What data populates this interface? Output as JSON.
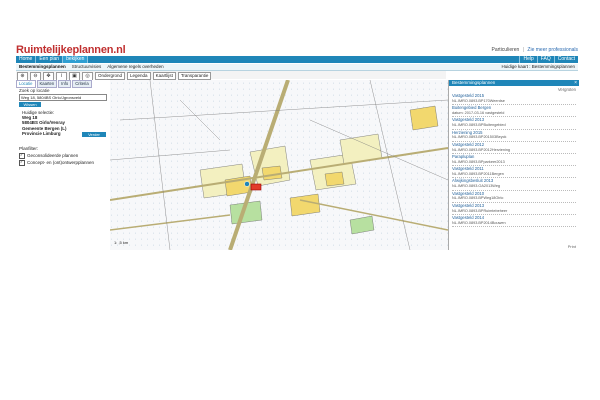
{
  "header": {
    "logo": "Ruimtelijkeplannen.nl",
    "top_links": [
      "Particulieren",
      "Zie meer professionals"
    ]
  },
  "nav": {
    "items": [
      "Home",
      "Een plan",
      "bekijken"
    ],
    "right_items": [
      "Help",
      "FAQ",
      "Contact"
    ]
  },
  "subnav": {
    "items": [
      "Bestemmingsplannen",
      "Structuurvisies",
      "Algemene regels overheden"
    ],
    "right": "Huidige kaart : Bestemmingsplannen"
  },
  "toolbar": {
    "labels": [
      "Ondergrond",
      "Legenda",
      "Kaartlijst",
      "Transparantie"
    ]
  },
  "left_panel": {
    "tabs": [
      "Locatie",
      "Kaarten",
      "Info",
      "Criteria"
    ],
    "search_label": "Zoek op locatie",
    "search_value": "Weg 18, 5804BS Oirlo/Jgronsveld",
    "wissen": "Wissen",
    "address_lines": [
      "Huidige selectie:",
      "Weg 18",
      "5804BS Oirlo/Venray",
      "Gemeente Bergen (L)",
      "Provincie Limburg"
    ],
    "verder": "Verder",
    "plan_title": "Planfilter:",
    "checkboxes": [
      "Geconsolideerde plannen",
      "Concept- en (ont)ontwerpplannen"
    ]
  },
  "right_panel": {
    "title": "Bestemmingsplannen",
    "sub": "Vergroten",
    "entries": [
      {
        "t": "Vastgesteld 2015",
        "s": "NL.IMRO.0893.BP170Weerdse"
      },
      {
        "t": "Buitengebied Bergen",
        "s": "datum: 2017-03-16 vastgesteld"
      },
      {
        "t": "Vastgesteld 2013",
        "s": "NL.IMRO.0893.BPBuitengebied"
      },
      {
        "t": "Herziening 2015",
        "s": "NL.IMRO.0893.BP201503Beyck"
      },
      {
        "t": "Vastgesteld 2012",
        "s": "NL.IMRO.0893.BP2012Herziening"
      },
      {
        "t": "Parapluplan",
        "s": "NL.IMRO.0893.BPparkeer2013"
      },
      {
        "t": "Vastgesteld 2011",
        "s": "NL.IMRO.0893.BP2011Bergen"
      },
      {
        "t": "Afwijkingsbesluit 2013",
        "s": "NL.IMRO.0893.OA2013Weg"
      },
      {
        "t": "Vastgesteld 2010",
        "s": "NL.IMRO.0893.BPWeg18Oirlo"
      },
      {
        "t": "Vastgesteld 2013",
        "s": "NL.IMRO.0893.BPRuimtebeheer"
      },
      {
        "t": "Vastgesteld 2014",
        "s": "NL.IMRO.0893.BP2014Bouwen"
      }
    ],
    "footer": "Print"
  },
  "map": {
    "scale_label": "1:  ,5 km",
    "colors": {
      "background": "#f7f8fa",
      "agri": "#f3f0c0",
      "residential": "#f2d86e",
      "road": "#cfc48e",
      "green": "#b7e0a0",
      "selection": "#e23a2a"
    }
  }
}
